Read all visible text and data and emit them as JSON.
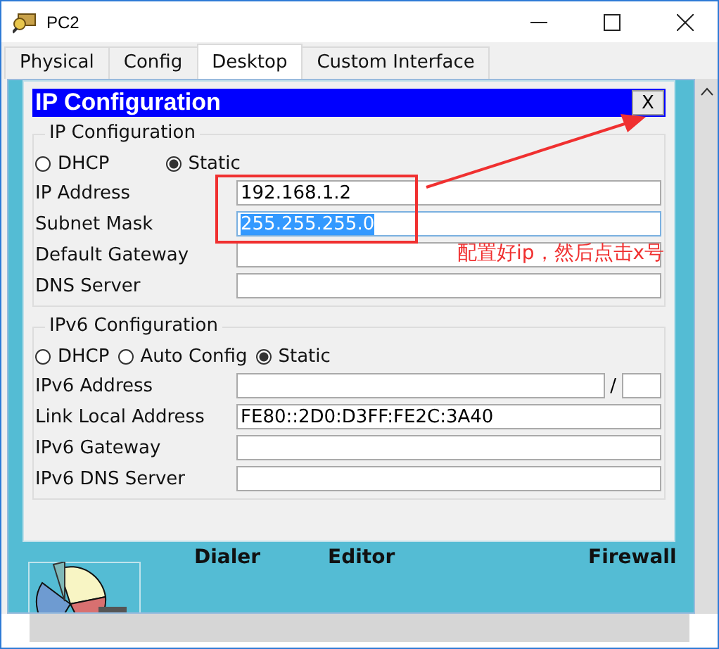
{
  "window": {
    "title": "PC2"
  },
  "tabs": [
    {
      "label": "Physical",
      "selected": false
    },
    {
      "label": "Config",
      "selected": false
    },
    {
      "label": "Desktop",
      "selected": true
    },
    {
      "label": "Custom Interface",
      "selected": false
    }
  ],
  "dialog": {
    "title": "IP Configuration",
    "close": "X",
    "ipv4": {
      "legend": "IP Configuration",
      "modes": [
        {
          "label": "DHCP",
          "selected": false
        },
        {
          "label": "Static",
          "selected": true
        }
      ],
      "fields": [
        {
          "label": "IP Address",
          "value": "192.168.1.2",
          "highlighted": false
        },
        {
          "label": "Subnet Mask",
          "value": "255.255.255.0",
          "highlighted": true
        },
        {
          "label": "Default Gateway",
          "highlighted": false
        },
        {
          "label": "DNS Server",
          "highlighted": false
        }
      ]
    },
    "ipv6": {
      "legend": "IPv6 Configuration",
      "modes": [
        {
          "label": "DHCP",
          "selected": false
        },
        {
          "label": "Auto Config",
          "selected": false
        },
        {
          "label": "Static",
          "selected": true
        }
      ],
      "fields": [
        {
          "label": "IPv6 Address",
          "kind": "prefixed",
          "separator": "/"
        },
        {
          "label": "Link Local Address",
          "kind": "plain",
          "value": "FE80::2D0:D3FF:FE2C:3A40"
        },
        {
          "label": "IPv6 Gateway",
          "kind": "plain"
        },
        {
          "label": "IPv6 DNS Server",
          "kind": "plain"
        }
      ]
    }
  },
  "desktop_apps": [
    {
      "label": "Dialer"
    },
    {
      "label": "Editor"
    },
    {
      "label": "Firewall"
    }
  ],
  "annotation": {
    "text": "配置好ip，然后点击x号"
  }
}
